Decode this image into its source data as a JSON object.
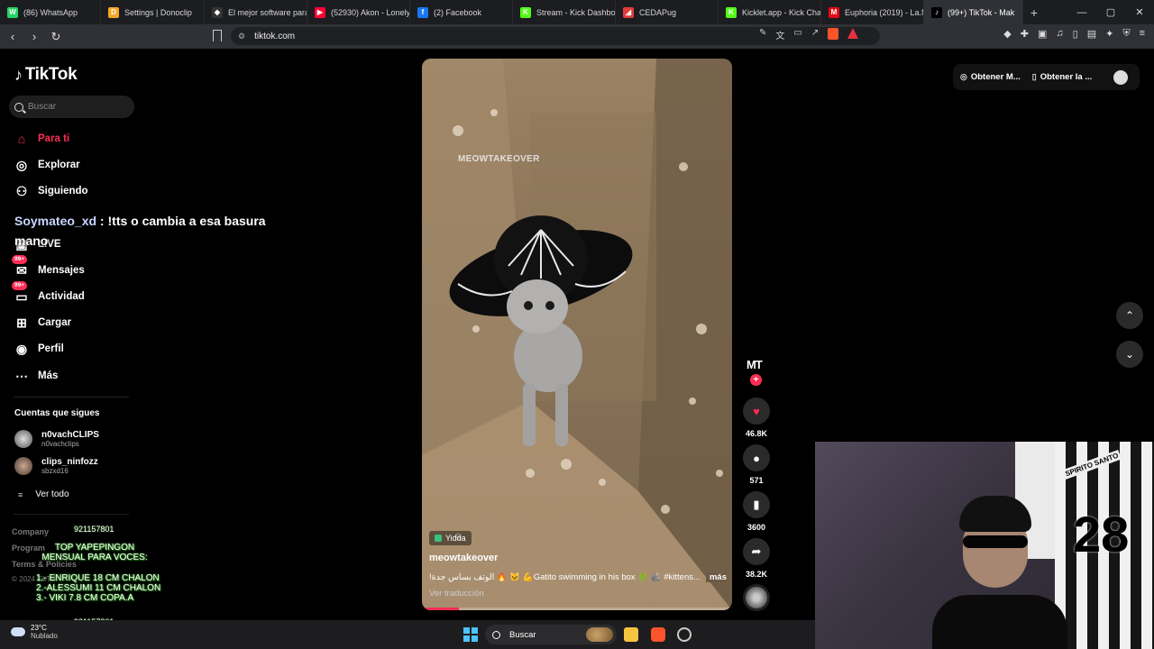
{
  "browser": {
    "tabs": [
      {
        "title": "(86) WhatsApp",
        "color": "#25d366",
        "glyph": "W"
      },
      {
        "title": "Settings | Donoclip",
        "color": "#f5a623",
        "glyph": "D"
      },
      {
        "title": "El mejor software para",
        "color": "#333333",
        "glyph": "◆"
      },
      {
        "title": "(52930) Akon - Lonely",
        "color": "#ff0033",
        "glyph": "▶"
      },
      {
        "title": "(2) Facebook",
        "color": "#1877f2",
        "glyph": "f"
      },
      {
        "title": "Stream - Kick Dashboa",
        "color": "#53fc18",
        "glyph": "K"
      },
      {
        "title": "CEDAPug",
        "color": "#e23b3b",
        "glyph": "◢"
      },
      {
        "title": "Kicklet.app - Kick Chat",
        "color": "#53fc18",
        "glyph": "K"
      },
      {
        "title": "Euphoria (2019) - La.M",
        "color": "#e50914",
        "glyph": "M"
      },
      {
        "title": "(99+) TikTok - Mak",
        "color": "#000000",
        "glyph": "♪",
        "active": true
      }
    ],
    "new_tab": "+",
    "window_controls": [
      "—",
      "▢",
      "✕"
    ],
    "url": "tiktok.com",
    "tab_close": "×"
  },
  "tiktok": {
    "logo": "TikTok",
    "search_placeholder": "Buscar",
    "nav": {
      "for_you": "Para ti",
      "explore": "Explorar",
      "following": "Siguiendo",
      "live": "LIVE",
      "messages": "Mensajes",
      "activity": "Actividad",
      "upload": "Cargar",
      "profile": "Perfil",
      "more": "Más",
      "badge": "99+"
    },
    "following_title": "Cuentas que sigues",
    "accounts": [
      {
        "name": "n0vachCLIPS",
        "handle": "n0vachclips"
      },
      {
        "name": "clips_ninfozz",
        "handle": "sbzxd16"
      }
    ],
    "see_all": "Ver todo",
    "footer": {
      "company": "Company",
      "program": "Program",
      "terms": "Terms & Policies",
      "copyright": "© 2024 TikTok"
    },
    "top_right": {
      "get_coins": "Obtener M...",
      "get_app": "Obtener la ..."
    },
    "video": {
      "watermark": "MEOWTAKEOVER",
      "effect_label": "Yidda",
      "author": "meowtakeover",
      "description": "!الوتف بساس جدة 🔥 🐱 💪Gatito swimming in his box 🌵 🪨 #kittens...",
      "more": "más",
      "translate": "Ver traducción",
      "progress": 0.12,
      "creator_initials": "MT",
      "likes": "46.8K",
      "comments": "571",
      "saves": "3600",
      "shares": "38.2K"
    }
  },
  "overlay": {
    "chat_user": "Soymateo_xd",
    "chat_message": " : !tts o cambia a esa basura mano",
    "promo_title": "TOP YAPEPINGON MENSUAL PARA VOCES:",
    "promo_lines": [
      "1.- ENRIQUE 18 CM CHALON",
      "2.-ALESSUMI 11 CM CHALON",
      "3.- VIKI 7.8 CM COPA.A"
    ],
    "phone_top": "921157801",
    "phone_bottom": "921157801"
  },
  "webcam": {
    "jersey_number": "28",
    "jersey_text": "SPIRITO SANTO"
  },
  "taskbar": {
    "temp": "23°C",
    "weather": "Nublado",
    "search": "Buscar"
  }
}
